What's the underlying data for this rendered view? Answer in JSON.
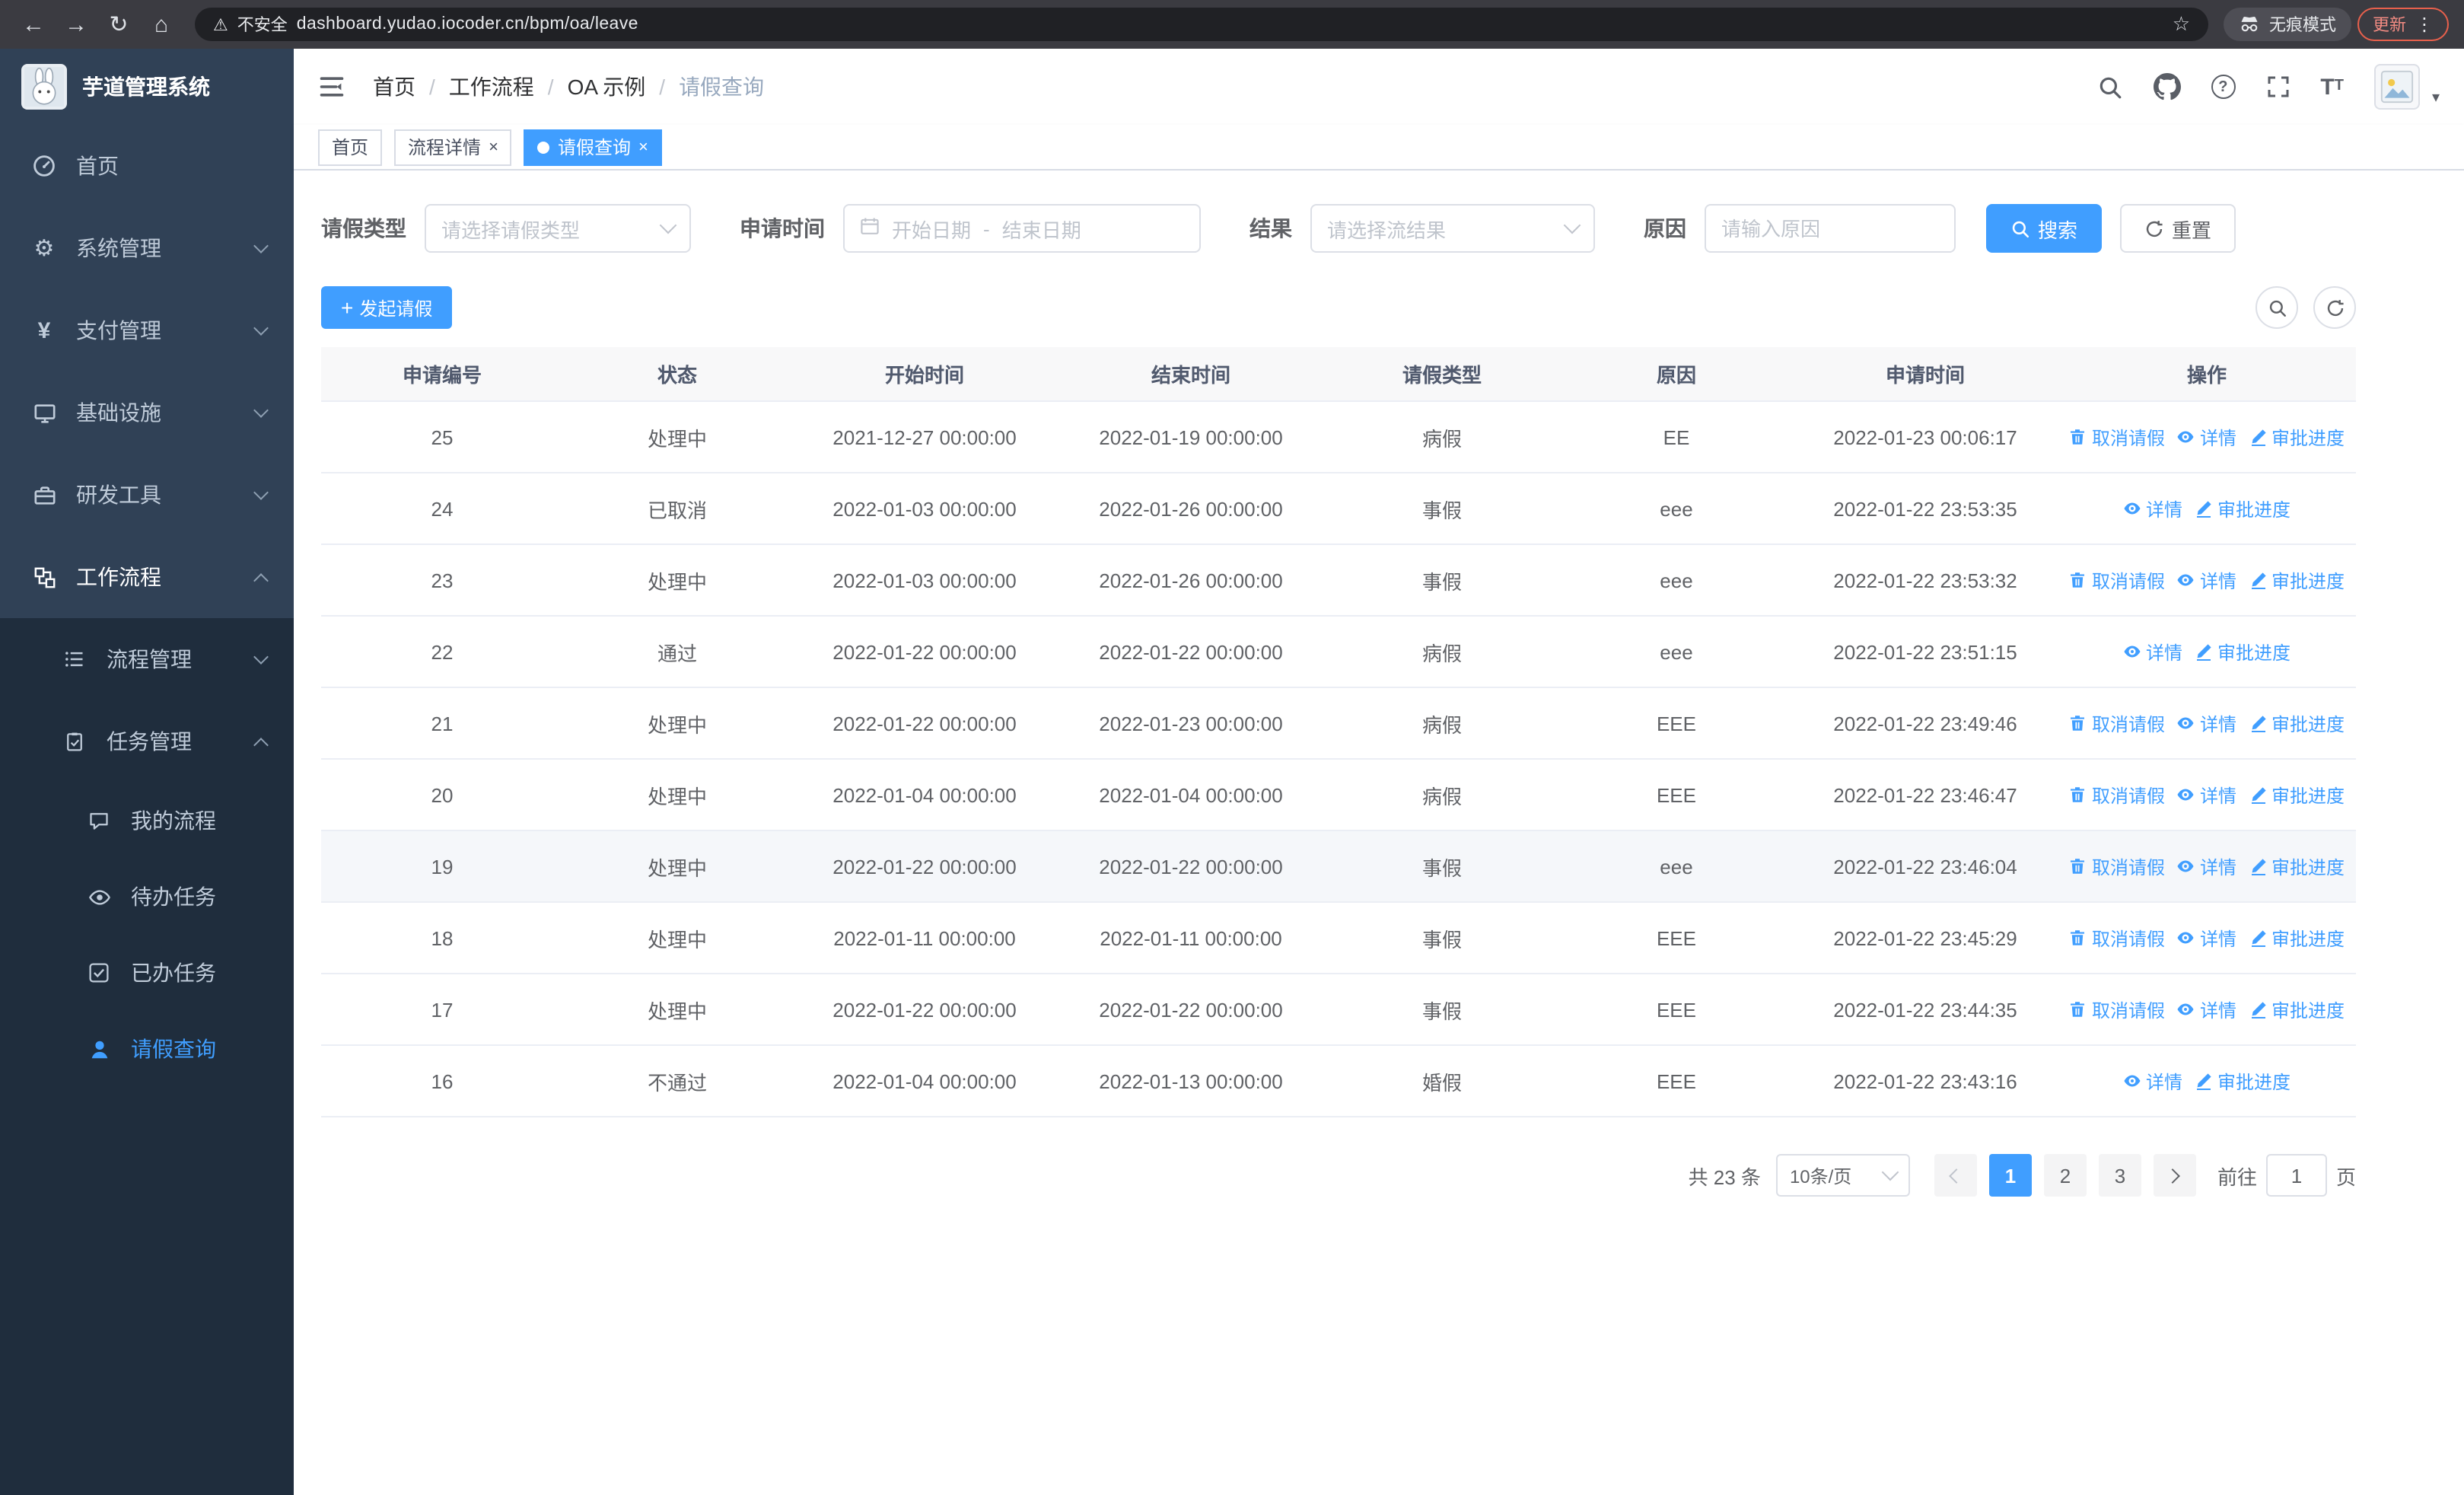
{
  "browser": {
    "security_label": "不安全",
    "url": "dashboard.yudao.iocoder.cn/bpm/oa/leave",
    "incognito_label": "无痕模式",
    "update_label": "更新"
  },
  "sidebar": {
    "logo_title": "芋道管理系统",
    "items": [
      {
        "label": "首页"
      },
      {
        "label": "系统管理"
      },
      {
        "label": "支付管理"
      },
      {
        "label": "基础设施"
      },
      {
        "label": "研发工具"
      },
      {
        "label": "工作流程"
      }
    ],
    "submenu": [
      {
        "label": "流程管理"
      },
      {
        "label": "任务管理"
      }
    ],
    "task_items": [
      {
        "label": "我的流程"
      },
      {
        "label": "待办任务"
      },
      {
        "label": "已办任务"
      },
      {
        "label": "请假查询"
      }
    ]
  },
  "navbar": {
    "breadcrumb": [
      {
        "label": "首页"
      },
      {
        "label": "工作流程"
      },
      {
        "label": "OA 示例"
      },
      {
        "label": "请假查询"
      }
    ]
  },
  "tabs": [
    {
      "label": "首页"
    },
    {
      "label": "流程详情"
    },
    {
      "label": "请假查询"
    }
  ],
  "filters": {
    "leave_type_label": "请假类型",
    "leave_type_placeholder": "请选择请假类型",
    "apply_time_label": "申请时间",
    "start_date_placeholder": "开始日期",
    "date_separator": "-",
    "end_date_placeholder": "结束日期",
    "result_label": "结果",
    "result_placeholder": "请选择流结果",
    "reason_label": "原因",
    "reason_placeholder": "请输入原因",
    "search_label": "搜索",
    "reset_label": "重置"
  },
  "toolbar": {
    "create_label": "发起请假"
  },
  "table": {
    "columns": [
      "申请编号",
      "状态",
      "开始时间",
      "结束时间",
      "请假类型",
      "原因",
      "申请时间",
      "操作"
    ],
    "action_defs": {
      "cancel": {
        "label": "取消请假",
        "icon": "delete-icon"
      },
      "detail": {
        "label": "详情",
        "icon": "view-icon"
      },
      "progress": {
        "label": "审批进度",
        "icon": "edit-icon"
      }
    },
    "rows": [
      {
        "id": "25",
        "status": "处理中",
        "start": "2021-12-27 00:00:00",
        "end": "2022-01-19 00:00:00",
        "type": "病假",
        "reason": "EE",
        "apply_time": "2022-01-23 00:06:17",
        "actions": [
          "cancel",
          "detail",
          "progress"
        ]
      },
      {
        "id": "24",
        "status": "已取消",
        "start": "2022-01-03 00:00:00",
        "end": "2022-01-26 00:00:00",
        "type": "事假",
        "reason": "eee",
        "apply_time": "2022-01-22 23:53:35",
        "actions": [
          "detail",
          "progress"
        ]
      },
      {
        "id": "23",
        "status": "处理中",
        "start": "2022-01-03 00:00:00",
        "end": "2022-01-26 00:00:00",
        "type": "事假",
        "reason": "eee",
        "apply_time": "2022-01-22 23:53:32",
        "actions": [
          "cancel",
          "detail",
          "progress"
        ]
      },
      {
        "id": "22",
        "status": "通过",
        "start": "2022-01-22 00:00:00",
        "end": "2022-01-22 00:00:00",
        "type": "病假",
        "reason": "eee",
        "apply_time": "2022-01-22 23:51:15",
        "actions": [
          "detail",
          "progress"
        ]
      },
      {
        "id": "21",
        "status": "处理中",
        "start": "2022-01-22 00:00:00",
        "end": "2022-01-23 00:00:00",
        "type": "病假",
        "reason": "EEE",
        "apply_time": "2022-01-22 23:49:46",
        "actions": [
          "cancel",
          "detail",
          "progress"
        ]
      },
      {
        "id": "20",
        "status": "处理中",
        "start": "2022-01-04 00:00:00",
        "end": "2022-01-04 00:00:00",
        "type": "病假",
        "reason": "EEE",
        "apply_time": "2022-01-22 23:46:47",
        "actions": [
          "cancel",
          "detail",
          "progress"
        ]
      },
      {
        "id": "19",
        "status": "处理中",
        "start": "2022-01-22 00:00:00",
        "end": "2022-01-22 00:00:00",
        "type": "事假",
        "reason": "eee",
        "apply_time": "2022-01-22 23:46:04",
        "actions": [
          "cancel",
          "detail",
          "progress"
        ],
        "hover": true
      },
      {
        "id": "18",
        "status": "处理中",
        "start": "2022-01-11 00:00:00",
        "end": "2022-01-11 00:00:00",
        "type": "事假",
        "reason": "EEE",
        "apply_time": "2022-01-22 23:45:29",
        "actions": [
          "cancel",
          "detail",
          "progress"
        ]
      },
      {
        "id": "17",
        "status": "处理中",
        "start": "2022-01-22 00:00:00",
        "end": "2022-01-22 00:00:00",
        "type": "事假",
        "reason": "EEE",
        "apply_time": "2022-01-22 23:44:35",
        "actions": [
          "cancel",
          "detail",
          "progress"
        ]
      },
      {
        "id": "16",
        "status": "不通过",
        "start": "2022-01-04 00:00:00",
        "end": "2022-01-13 00:00:00",
        "type": "婚假",
        "reason": "EEE",
        "apply_time": "2022-01-22 23:43:16",
        "actions": [
          "detail",
          "progress"
        ]
      }
    ]
  },
  "pagination": {
    "total_label": "共 23 条",
    "page_size": "10条/页",
    "pages": [
      "1",
      "2",
      "3"
    ],
    "goto_label": "前往",
    "goto_value": "1",
    "page_unit": "页"
  }
}
